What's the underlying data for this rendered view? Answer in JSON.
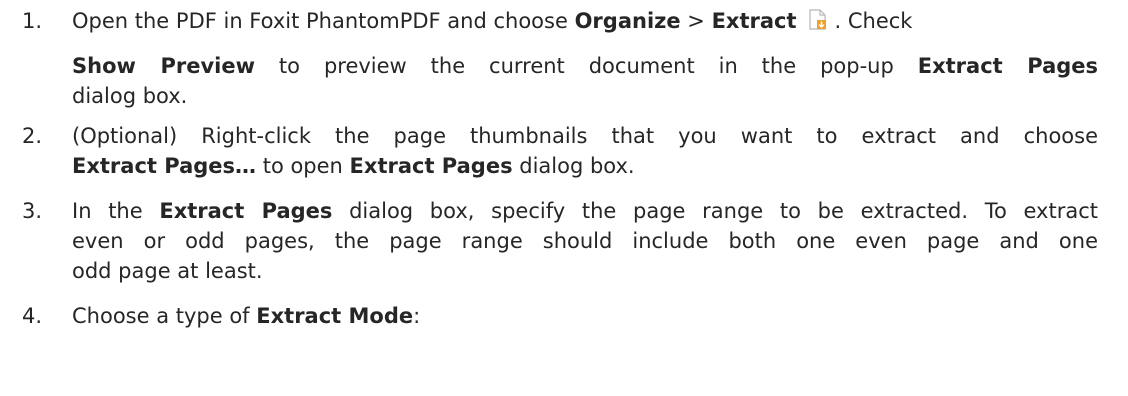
{
  "steps": [
    {
      "number": "1.",
      "lines": [
        {
          "t1": "Open the PDF in Foxit PhantomPDF and choose ",
          "b1": "Organize",
          "t2": " > ",
          "b2": "Extract",
          "icon": "extract-pages-icon",
          "t3": ". Check"
        },
        {
          "b1": "Show Preview",
          "t1": " to preview the current document in the pop-up ",
          "b2": "Extract Pages"
        },
        {
          "t1": "dialog box."
        }
      ]
    },
    {
      "number": "2.",
      "lines": [
        {
          "t1": "(Optional) Right-click the page thumbnails that you want to extract and choose"
        },
        {
          "b1": "Extract Pages…",
          "t1": " to open ",
          "b2": "Extract Pages",
          "t2": " dialog box."
        }
      ]
    },
    {
      "number": "3.",
      "lines": [
        {
          "t1": "In the ",
          "b1": "Extract Pages",
          "t2": " dialog box, specify the page range to be extracted. To extract"
        },
        {
          "t1": "even or odd pages, the page range should include both one even page and one"
        },
        {
          "t1": "odd page at least."
        }
      ]
    },
    {
      "number": "4.",
      "lines": [
        {
          "t1": "Choose a type of ",
          "b1": "Extract Mode",
          "t2": ":"
        }
      ]
    }
  ],
  "colors": {
    "text": "#262626",
    "icon_page": "#d9d9d9",
    "icon_accent": "#f0a030"
  }
}
